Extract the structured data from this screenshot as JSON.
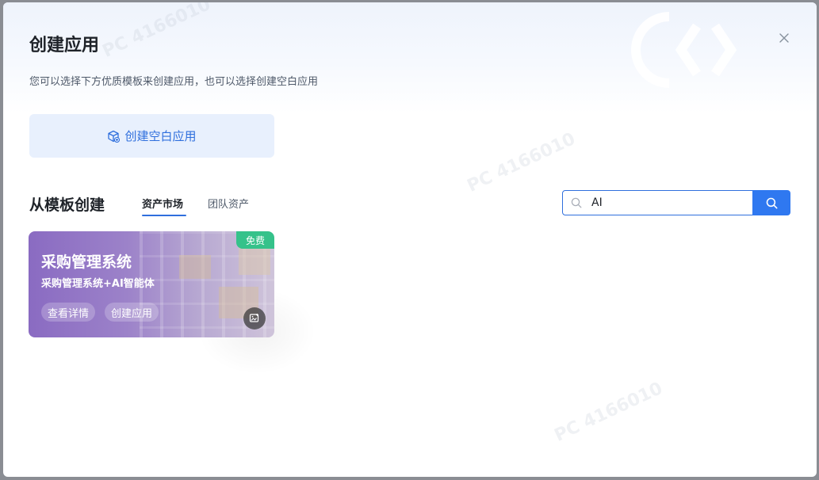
{
  "dialog": {
    "title": "创建应用",
    "subtitle": "您可以选择下方优质模板来创建应用，也可以选择创建空白应用",
    "close_icon": "close-icon",
    "watermark": "PC 4166010"
  },
  "blank_app": {
    "label": "创建空白应用",
    "icon": "cube-plus-icon"
  },
  "templates": {
    "section_title": "从模板创建",
    "tabs": [
      {
        "label": "资产市场",
        "active": true
      },
      {
        "label": "团队资产",
        "active": false
      }
    ],
    "search": {
      "value": "AI",
      "placeholder": "",
      "icon": "search-icon"
    },
    "cards": [
      {
        "title": "采购管理系统",
        "subtitle": "采购管理系统+AI智能体",
        "badge": "免费",
        "buttons": [
          "查看详情",
          "创建应用"
        ],
        "icon": "image-edit-icon"
      }
    ]
  },
  "colors": {
    "accent": "#2f78f0",
    "badge": "#35c28a"
  }
}
